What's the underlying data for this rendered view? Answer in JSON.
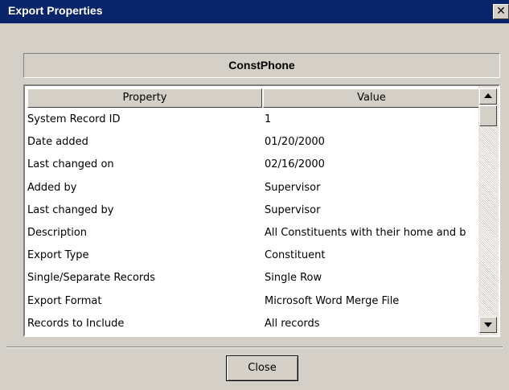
{
  "window": {
    "title": "Export Properties",
    "close_glyph": "✕"
  },
  "record_name": "ConstPhone",
  "table": {
    "columns": [
      "Property",
      "Value"
    ],
    "rows": [
      [
        "System Record ID",
        "1"
      ],
      [
        "Date added",
        "01/20/2000"
      ],
      [
        "Last changed on",
        "02/16/2000"
      ],
      [
        "Added by",
        "Supervisor"
      ],
      [
        "Last changed by",
        "Supervisor"
      ],
      [
        "Description",
        "All Constituents with their home and b"
      ],
      [
        "Export Type",
        "Constituent"
      ],
      [
        "Single/Separate Records",
        "Single Row"
      ],
      [
        "Export Format",
        "Microsoft Word Merge File"
      ],
      [
        "Records to Include",
        "All records"
      ]
    ]
  },
  "footer": {
    "close_label": "Close"
  },
  "icons": {
    "titlebar_close": "close-icon",
    "scroll_up": "up-arrow-icon",
    "scroll_down": "down-arrow-icon"
  },
  "colors": {
    "titlebar": "#0a246a",
    "face": "#d4d0c8"
  }
}
